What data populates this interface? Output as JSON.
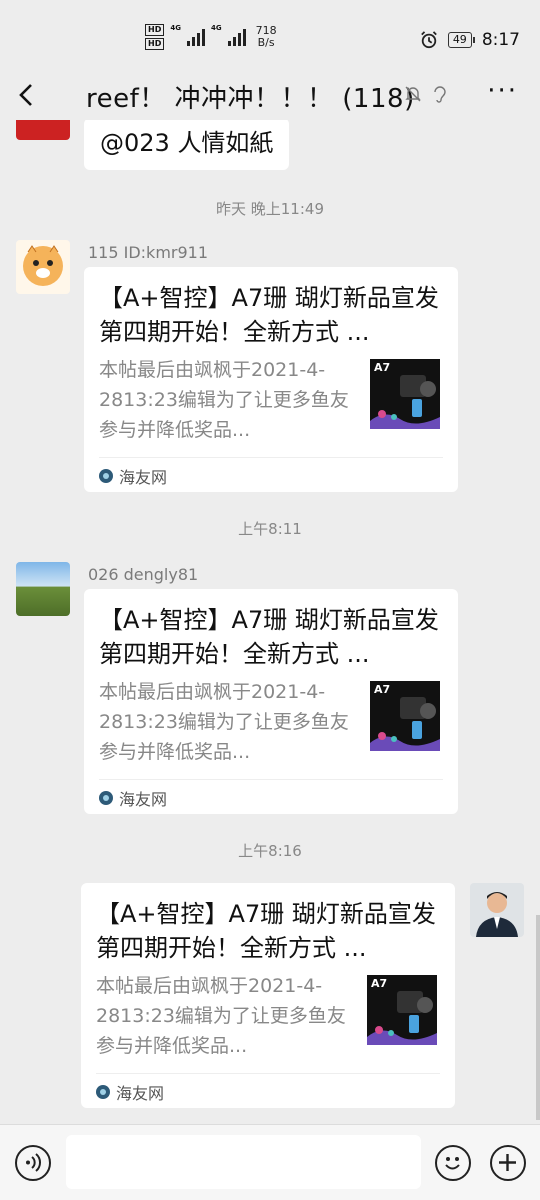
{
  "status_bar": {
    "hd1": "HD",
    "hd2": "HD",
    "net1": "4G",
    "net2": "4G",
    "speed_value": "718",
    "speed_unit": "B/s",
    "battery": "49",
    "time": "8:17"
  },
  "header": {
    "title": "reef！ 冲冲冲！！！ (118)"
  },
  "messages": {
    "partial_text": "@023 人情如紙",
    "time1": "昨天 晚上11:49",
    "time2": "上午8:11",
    "time3": "上午8:16",
    "card_title": "【A+智控】A7珊 瑚灯新品宣发  第四期开始！全新方式  ...",
    "card_desc": "本帖最后由飒枫于2021-4-2813:23编辑为了让更多鱼友参与并降低奖品...",
    "card_source": "海友网",
    "thumb_title": "A7",
    "sender1": "115 ID:kmr911",
    "sender2": "026 dengly81"
  }
}
